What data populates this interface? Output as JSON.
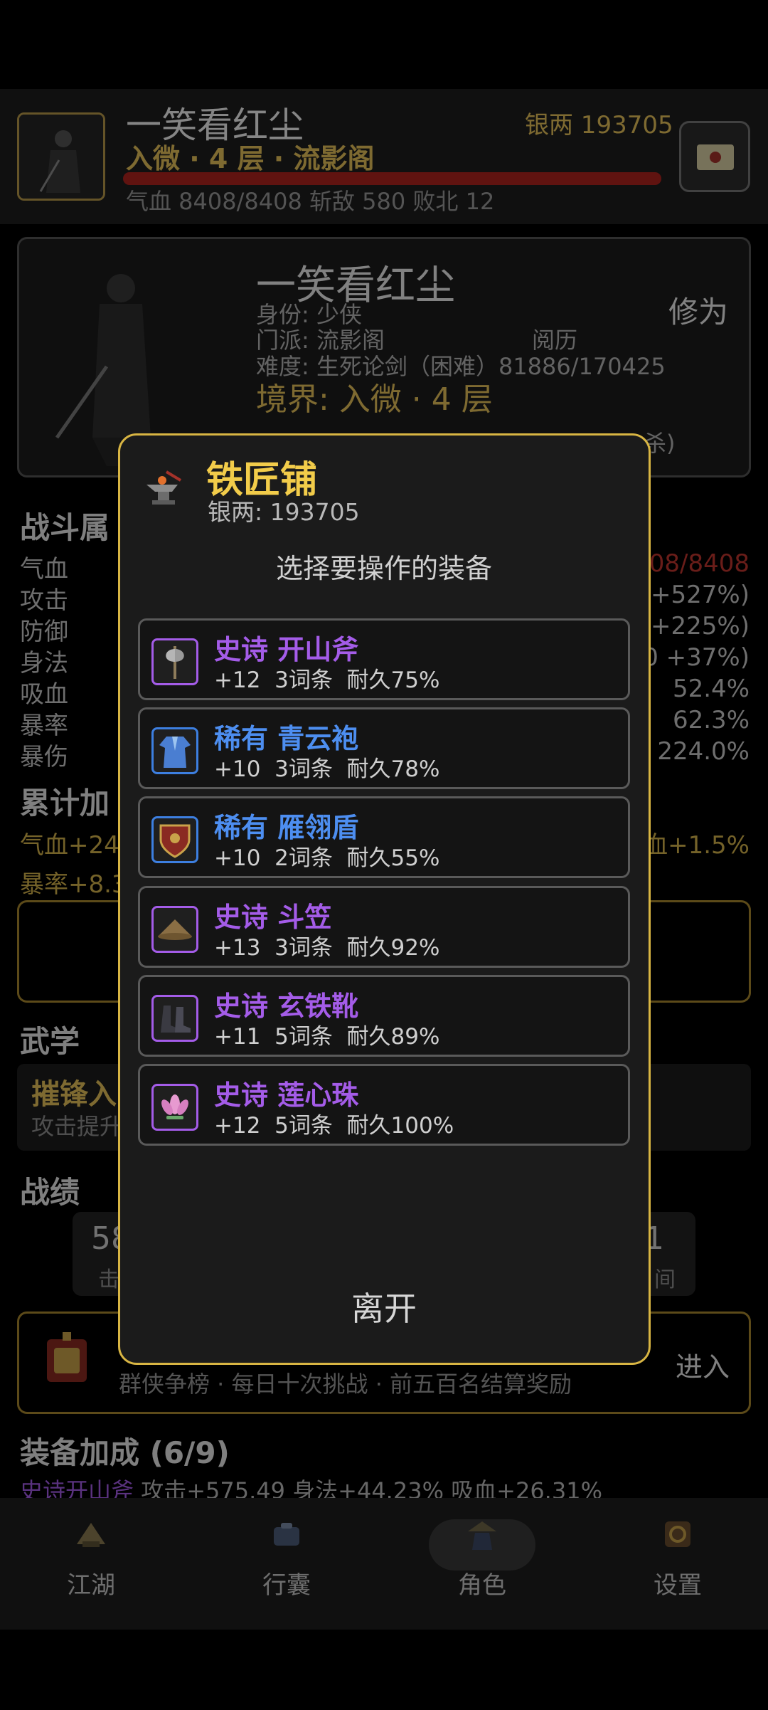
{
  "header": {
    "name": "一笑看红尘",
    "realm": "入微 · 4 层 · 流影阁",
    "silver": "银两 193705",
    "stats": "气血 8408/8408   斩敌 580   败北 12"
  },
  "character": {
    "name": "一笑看红尘",
    "identity": "身份: 少侠",
    "sect": "门派: 流影阁",
    "experience_label": "阅历",
    "difficulty": "难度: 生死论剑（困难）81886/170425",
    "realm": "境界: 入微 · 4 层",
    "cultivation_label": "修为",
    "partial_line": "杀)"
  },
  "combat": {
    "title": "战斗属",
    "stats": [
      {
        "label": "气血",
        "value": "08/8408"
      },
      {
        "label": "攻击",
        "value": "+527%)"
      },
      {
        "label": "防御",
        "value": "+225%)"
      },
      {
        "label": "身法",
        "value": "0 +37%)"
      },
      {
        "label": "吸血",
        "value": "52.4%"
      },
      {
        "label": "暴率",
        "value": "62.3%"
      },
      {
        "label": "暴伤",
        "value": "224.0%"
      }
    ],
    "cumulative_title": "累计加",
    "cumulative_line1_left": "气血+24",
    "cumulative_line1_right": "血+1.5%",
    "cumulative_line2": "暴率+8.3"
  },
  "martial": {
    "title": "武学",
    "skill_name": "摧锋入",
    "skill_desc": "攻击提升"
  },
  "records": {
    "title": "战绩",
    "left_value": "58",
    "left_label": "击",
    "right_value": "1",
    "right_label": "间"
  },
  "arena": {
    "text": "群侠争榜 · 每日十次挑战 · 前五百名结算奖励",
    "enter_label": "进入"
  },
  "equip_bonus": {
    "title": "装备加成 (6/9)",
    "item": "史诗开山斧",
    "bonus": " 攻击+575.49 身法+44.23% 吸血+26.31%"
  },
  "nav": [
    {
      "label": "江湖",
      "icon": "jianghu-icon"
    },
    {
      "label": "行囊",
      "icon": "bag-icon"
    },
    {
      "label": "角色",
      "icon": "character-icon",
      "active": true
    },
    {
      "label": "设置",
      "icon": "settings-icon"
    }
  ],
  "modal": {
    "title": "铁匠铺",
    "silver": "银两: 193705",
    "subtitle": "选择要操作的装备",
    "leave_label": "离开",
    "items": [
      {
        "name": "史诗 开山斧",
        "info": "+12  3词条  耐久75%",
        "rarity": "epic",
        "icon": "axe-icon"
      },
      {
        "name": "稀有 青云袍",
        "info": "+10  3词条  耐久78%",
        "rarity": "rare",
        "icon": "robe-icon"
      },
      {
        "name": "稀有 雁翎盾",
        "info": "+10  2词条  耐久55%",
        "rarity": "rare",
        "icon": "shield-icon"
      },
      {
        "name": "史诗 斗笠",
        "info": "+13  3词条  耐久92%",
        "rarity": "epic",
        "icon": "hat-icon"
      },
      {
        "name": "史诗 玄铁靴",
        "info": "+11  5词条  耐久89%",
        "rarity": "epic",
        "icon": "boots-icon"
      },
      {
        "name": "史诗 莲心珠",
        "info": "+12  5词条  耐久100%",
        "rarity": "epic",
        "icon": "lotus-bead-icon"
      }
    ]
  },
  "colors": {
    "gold": "#e6c15a",
    "epic": "#a45ce8",
    "rare": "#4d8ef0",
    "hp_bar": "#b0231e",
    "modal_border": "#d8b543"
  }
}
